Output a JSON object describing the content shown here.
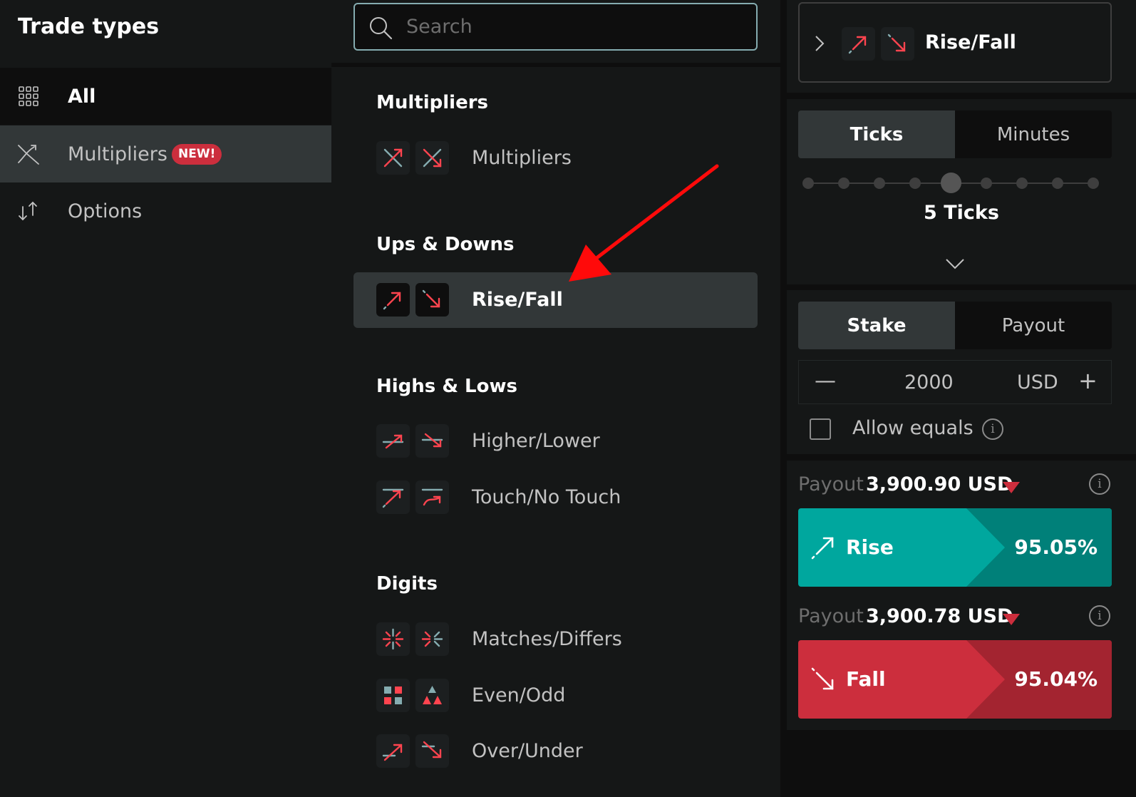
{
  "sidebar": {
    "title": "Trade types",
    "items": [
      {
        "label": "All",
        "icon": "grid-icon",
        "selected": true
      },
      {
        "label": "Multipliers",
        "icon": "multipliers-icon",
        "badge": "NEW!"
      },
      {
        "label": "Options",
        "icon": "options-arrows-icon"
      }
    ]
  },
  "search": {
    "placeholder": "Search"
  },
  "groups": [
    {
      "title": "Multipliers",
      "items": [
        {
          "label": "Multipliers",
          "icons": [
            "multiplier-up-icon",
            "multiplier-down-icon"
          ]
        }
      ]
    },
    {
      "title": "Ups & Downs",
      "items": [
        {
          "label": "Rise/Fall",
          "icons": [
            "rise-icon",
            "fall-icon"
          ],
          "selected": true
        }
      ]
    },
    {
      "title": "Highs & Lows",
      "items": [
        {
          "label": "Higher/Lower",
          "icons": [
            "higher-icon",
            "lower-icon"
          ]
        },
        {
          "label": "Touch/No Touch",
          "icons": [
            "touch-icon",
            "no-touch-icon"
          ]
        }
      ]
    },
    {
      "title": "Digits",
      "items": [
        {
          "label": "Matches/Differs",
          "icons": [
            "matches-icon",
            "differs-icon"
          ]
        },
        {
          "label": "Even/Odd",
          "icons": [
            "even-icon",
            "odd-icon"
          ]
        },
        {
          "label": "Over/Under",
          "icons": [
            "over-icon",
            "under-icon"
          ]
        }
      ]
    }
  ],
  "trade_panel": {
    "selected_trade": "Rise/Fall",
    "duration_tabs": [
      "Ticks",
      "Minutes"
    ],
    "active_duration_tab": "Ticks",
    "ticks_options_count": 9,
    "ticks_selected": 5,
    "ticks_label": "5 Ticks",
    "amount_tabs": [
      "Stake",
      "Payout"
    ],
    "active_amount_tab": "Stake",
    "minus": "—",
    "stake": "2000",
    "currency": "USD",
    "plus": "+",
    "allow_equals": "Allow equals",
    "allow_equals_checked": false,
    "info": "i",
    "payout_label": "Payout",
    "rise": {
      "payout": "3,900.90 USD",
      "label": "Rise",
      "percent": "95.05%"
    },
    "fall": {
      "payout": "3,900.78 USD",
      "label": "Fall",
      "percent": "95.04%"
    }
  },
  "colors": {
    "accent_red": "#ff444f",
    "badge_red": "#cc2e3d",
    "teal_icon": "#85acb0",
    "rise_green": "#00a79e",
    "rise_green_dark": "#008079",
    "fall_red": "#cc2e3d",
    "fall_red_dark": "#a32430",
    "annotation_arrow": "#ff0a0a"
  }
}
